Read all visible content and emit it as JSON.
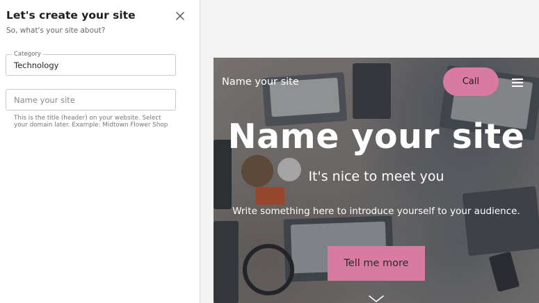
{
  "panel": {
    "title": "Let's create your site",
    "subtitle": "So, what's your site about?",
    "category_label": "Category",
    "category_value": "Technology",
    "name_placeholder": "Name your site",
    "name_value": "",
    "helper_text": "This is the title (header) on your website. Select your domain later. Example: Midtown Flower Shop"
  },
  "preview": {
    "site_name": "Name your site",
    "call_label": "Call",
    "hero_title": "Name your site",
    "hero_subtitle": "It's nice to meet you",
    "hero_intro": "Write something here to introduce yourself to your audience.",
    "cta_label": "Tell me more"
  },
  "icons": {
    "close": "close-icon",
    "menu": "hamburger-menu-icon",
    "scroll": "chevron-down-icon"
  },
  "colors": {
    "accent": "#d97aa0",
    "panel_bg": "#ffffff",
    "page_bg": "#f3f3f3"
  }
}
